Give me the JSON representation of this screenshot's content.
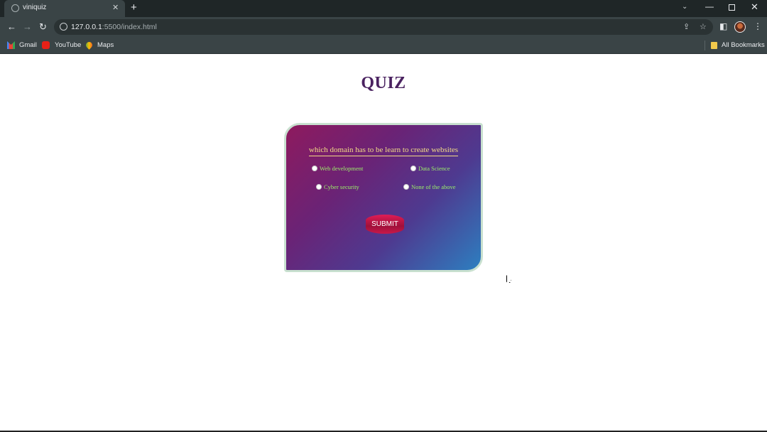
{
  "browser": {
    "tab_title": "viniquiz",
    "tab_close": "✕",
    "new_tab": "+",
    "url_host": "127.0.0.1",
    "url_rest": ":5500/index.html",
    "bookmarks": [
      {
        "label": "Gmail",
        "icon": "gmail-icon"
      },
      {
        "label": "YouTube",
        "icon": "youtube-icon"
      },
      {
        "label": "Maps",
        "icon": "maps-icon"
      }
    ],
    "all_bookmarks": "All Bookmarks"
  },
  "page": {
    "title": "QUIZ",
    "question": "which domain has to be learn to create websites",
    "options": [
      "Web development",
      "Data Science",
      "Cyber security",
      "None of the above"
    ],
    "submit_label": "SUBMIT"
  },
  "colors": {
    "title": "#4a2260",
    "question": "#f3dc86",
    "option_text": "#9cf06a",
    "card_gradient_start": "#8e1a5e",
    "card_gradient_end": "#2d7fc0",
    "submit": "#c9184a"
  }
}
